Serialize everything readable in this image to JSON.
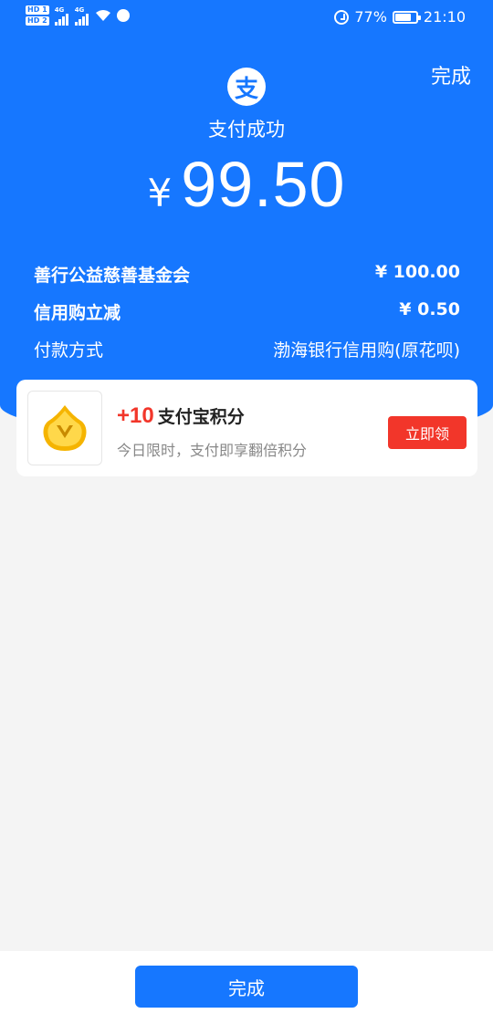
{
  "status_bar": {
    "sim1": "HD 1",
    "sim2": "HD 2",
    "network1": "4G",
    "network2": "4G",
    "battery_percent": "77%",
    "battery_level": 0.77,
    "time": "21:10"
  },
  "header": {
    "done_label": "完成",
    "logo_char": "支",
    "status": "支付成功",
    "currency": "¥",
    "amount": "99.50"
  },
  "details": [
    {
      "label": "善行公益慈善基金会",
      "value": "¥ 100.00"
    },
    {
      "label": "信用购立减",
      "value": "¥ 0.50"
    },
    {
      "label": "付款方式",
      "value": "渤海银行信用购(原花呗)"
    }
  ],
  "promo": {
    "icon": "alipay-points-coin-icon",
    "points": "+10",
    "title": "支付宝积分",
    "subtitle": "今日限时，支付即享翻倍积分",
    "button_label": "立即领"
  },
  "footer": {
    "done_label": "完成"
  },
  "colors": {
    "brand": "#1677ff",
    "accent_red": "#f2362a",
    "background": "#f4f4f4"
  }
}
